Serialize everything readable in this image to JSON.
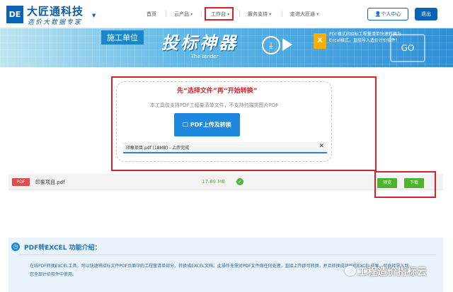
{
  "header": {
    "logo_mark": "DE",
    "logo_title": "大匠通科技",
    "logo_subtitle": "造价大数据专家",
    "nav": [
      "首页",
      "云产品",
      "工作台",
      "服务支持",
      "走进大匠通"
    ],
    "user_button": "个人中心",
    "logout_button": "退出"
  },
  "banner": {
    "tag": "施工单位",
    "title": "投标神器",
    "subtitle": "The tender",
    "description": "PDF格式的招标工程量清单快速转换为Excel格式，直接导入造价计价软件！",
    "go": "GO"
  },
  "upload": {
    "title": "先“选择文件”再“开始转换”",
    "hint": "本工具仅支持PDF工程量清单文件，不支持扫描类图片PDF",
    "button": "PDF上传及转换",
    "file_line": "印象项目.pdf (18MB) - 上传完成"
  },
  "file_row": {
    "badge": "PDF",
    "name": "印象项目.pdf",
    "size": "17.89 MB",
    "status": "success",
    "preview_button": "预览",
    "download_button": "下载"
  },
  "intro": {
    "title": "PDF转EXCEL 功能介绍：",
    "text": "在线PDF转换EXCEL工具，可以快速将招标文件PDF页面中的工程量清单部分，转换成EXCEL文档。此操作无需对PDF文件做任何处理，直接上传即可转换，并且转换成功后的EXCEL成果，可直接导入到您全部计价软件中使用。"
  },
  "watermark": "工程造价指标云",
  "colors": {
    "brand": "#0b63b6",
    "highlight": "#d9232b",
    "action": "#4bb32d",
    "file_badge": "#e14b4b"
  }
}
